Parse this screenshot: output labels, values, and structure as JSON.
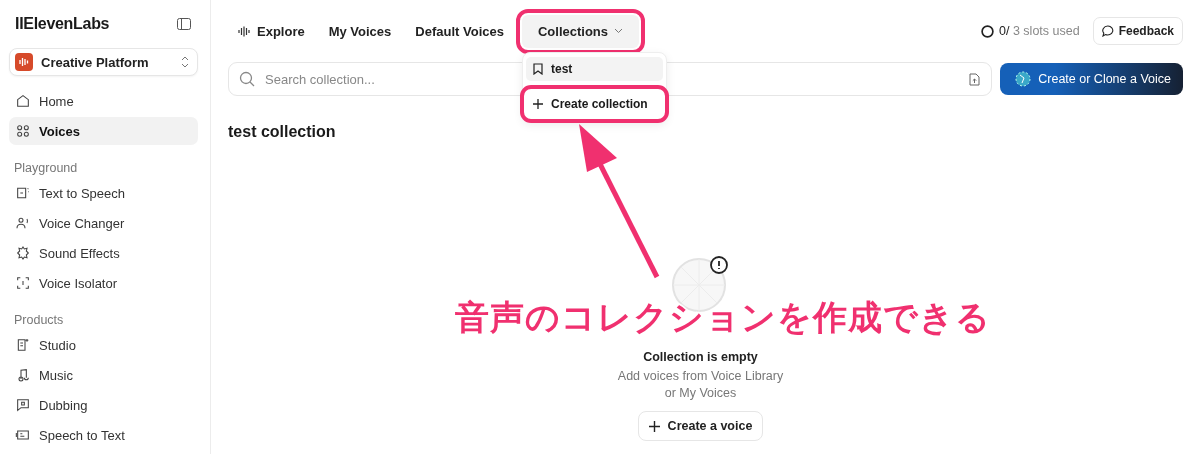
{
  "sidebar": {
    "logo": "IIElevenLabs",
    "workspace": "Creative Platform",
    "groups": [
      {
        "items": [
          {
            "label": "Home",
            "selected": false
          },
          {
            "label": "Voices",
            "selected": true
          }
        ]
      },
      {
        "heading": "Playground",
        "items": [
          {
            "label": "Text to Speech",
            "selected": false
          },
          {
            "label": "Voice Changer",
            "selected": false
          },
          {
            "label": "Sound Effects",
            "selected": false
          },
          {
            "label": "Voice Isolator",
            "selected": false
          }
        ]
      },
      {
        "heading": "Products",
        "items": [
          {
            "label": "Studio",
            "selected": false
          },
          {
            "label": "Music",
            "selected": false
          },
          {
            "label": "Dubbing",
            "selected": false
          },
          {
            "label": "Speech to Text",
            "selected": false
          }
        ]
      }
    ]
  },
  "tabs": [
    {
      "label": "Explore",
      "selected": false,
      "highlighted": false
    },
    {
      "label": "My Voices",
      "selected": false,
      "highlighted": false
    },
    {
      "label": "Default Voices",
      "selected": false,
      "highlighted": false
    },
    {
      "label": "Collections",
      "selected": true,
      "highlighted": true
    }
  ],
  "slots": {
    "used": "0/",
    "total": "3 slots used"
  },
  "feedback": "Feedback",
  "search": {
    "placeholder": "Search collection..."
  },
  "create_button": "Create or Clone a Voice",
  "dropdown": [
    {
      "label": "test",
      "kind": "collection",
      "highlighted": false
    },
    {
      "label": "Create collection",
      "kind": "create",
      "highlighted": true
    }
  ],
  "title": "test collection",
  "empty": {
    "title": "Collection is empty",
    "text": "Add voices from Voice Library\nor My Voices",
    "button": "Create a voice"
  },
  "annotation": {
    "caption": "音声のコレクションを作成できる"
  }
}
